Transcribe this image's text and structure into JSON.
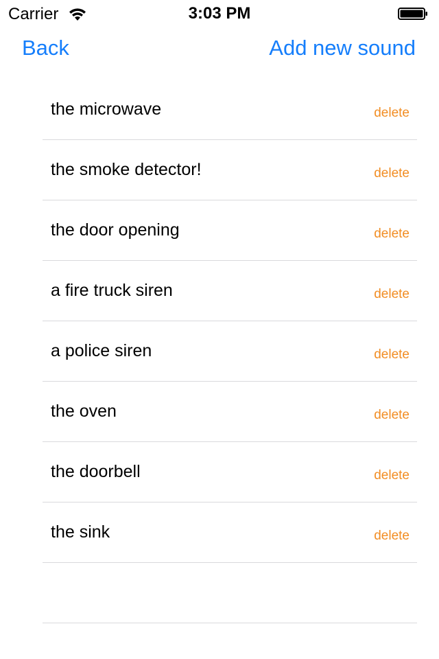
{
  "status_bar": {
    "carrier": "Carrier",
    "time": "3:03 PM",
    "wifi_icon": "wifi-icon",
    "battery_icon": "battery-icon"
  },
  "nav": {
    "back_label": "Back",
    "add_label": "Add new sound"
  },
  "colors": {
    "accent": "#157efb",
    "delete": "#f28d23",
    "separator": "#d9d9dc"
  },
  "sounds": [
    {
      "label": "the microwave",
      "delete": "delete"
    },
    {
      "label": "the smoke detector!",
      "delete": "delete"
    },
    {
      "label": "the door opening",
      "delete": "delete"
    },
    {
      "label": "a fire truck siren",
      "delete": "delete"
    },
    {
      "label": "a police siren",
      "delete": "delete"
    },
    {
      "label": "the oven",
      "delete": "delete"
    },
    {
      "label": "the doorbell",
      "delete": "delete"
    },
    {
      "label": "the sink",
      "delete": "delete"
    }
  ]
}
